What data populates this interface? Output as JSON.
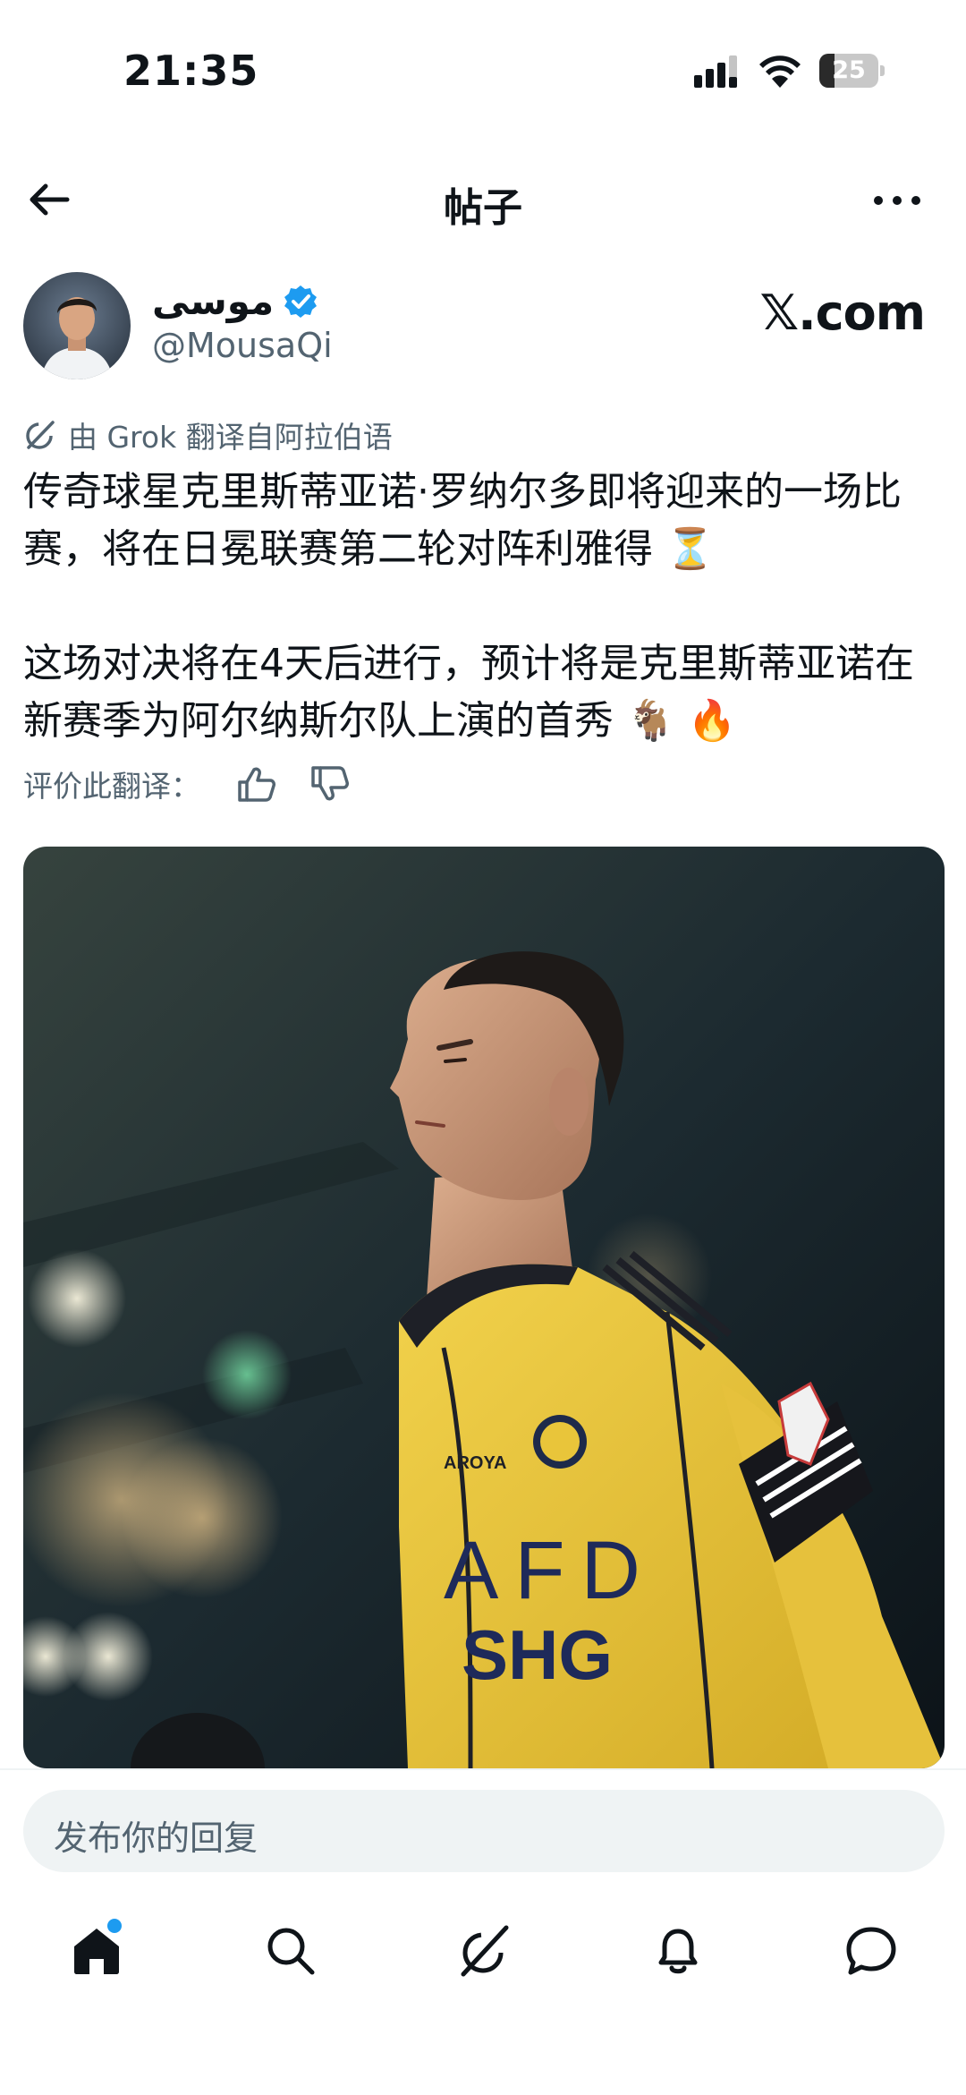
{
  "status_bar": {
    "time": "21:35",
    "battery_level": "25",
    "battery_fraction": 0.25
  },
  "header": {
    "title": "帖子"
  },
  "post": {
    "author_name": "موسى",
    "author_handle": "@MousaQi",
    "source": "𝕏.com",
    "translation_note": "由 Grok 翻译自阿拉伯语",
    "paragraph_1": "传奇球星克里斯蒂亚诺·罗纳尔多即将迎来的一场比赛，将在日冕联赛第二轮对阵利雅得 ⏳",
    "paragraph_2": "这场对决将在4天后进行，预计将是克里斯蒂亚诺在新赛季为阿尔纳斯尔队上演的首秀 🐐 🔥",
    "rating_label": "评价此翻译："
  },
  "media": {
    "jersey_sponsor_1": "AFD",
    "jersey_sponsor_2": "SHG",
    "jersey_sponsor_small": "AROYA"
  },
  "reply": {
    "placeholder": "发布你的回复"
  },
  "tab_bar": {
    "items": [
      {
        "icon": "home-icon",
        "has_notification": true
      },
      {
        "icon": "search-icon"
      },
      {
        "icon": "grok-icon"
      },
      {
        "icon": "bell-icon"
      },
      {
        "icon": "chat-icon"
      }
    ]
  },
  "colors": {
    "accent": "#1d9bf0",
    "text_primary": "#0f1419",
    "text_secondary": "#536471",
    "jersey_yellow": "#e9c53a"
  }
}
